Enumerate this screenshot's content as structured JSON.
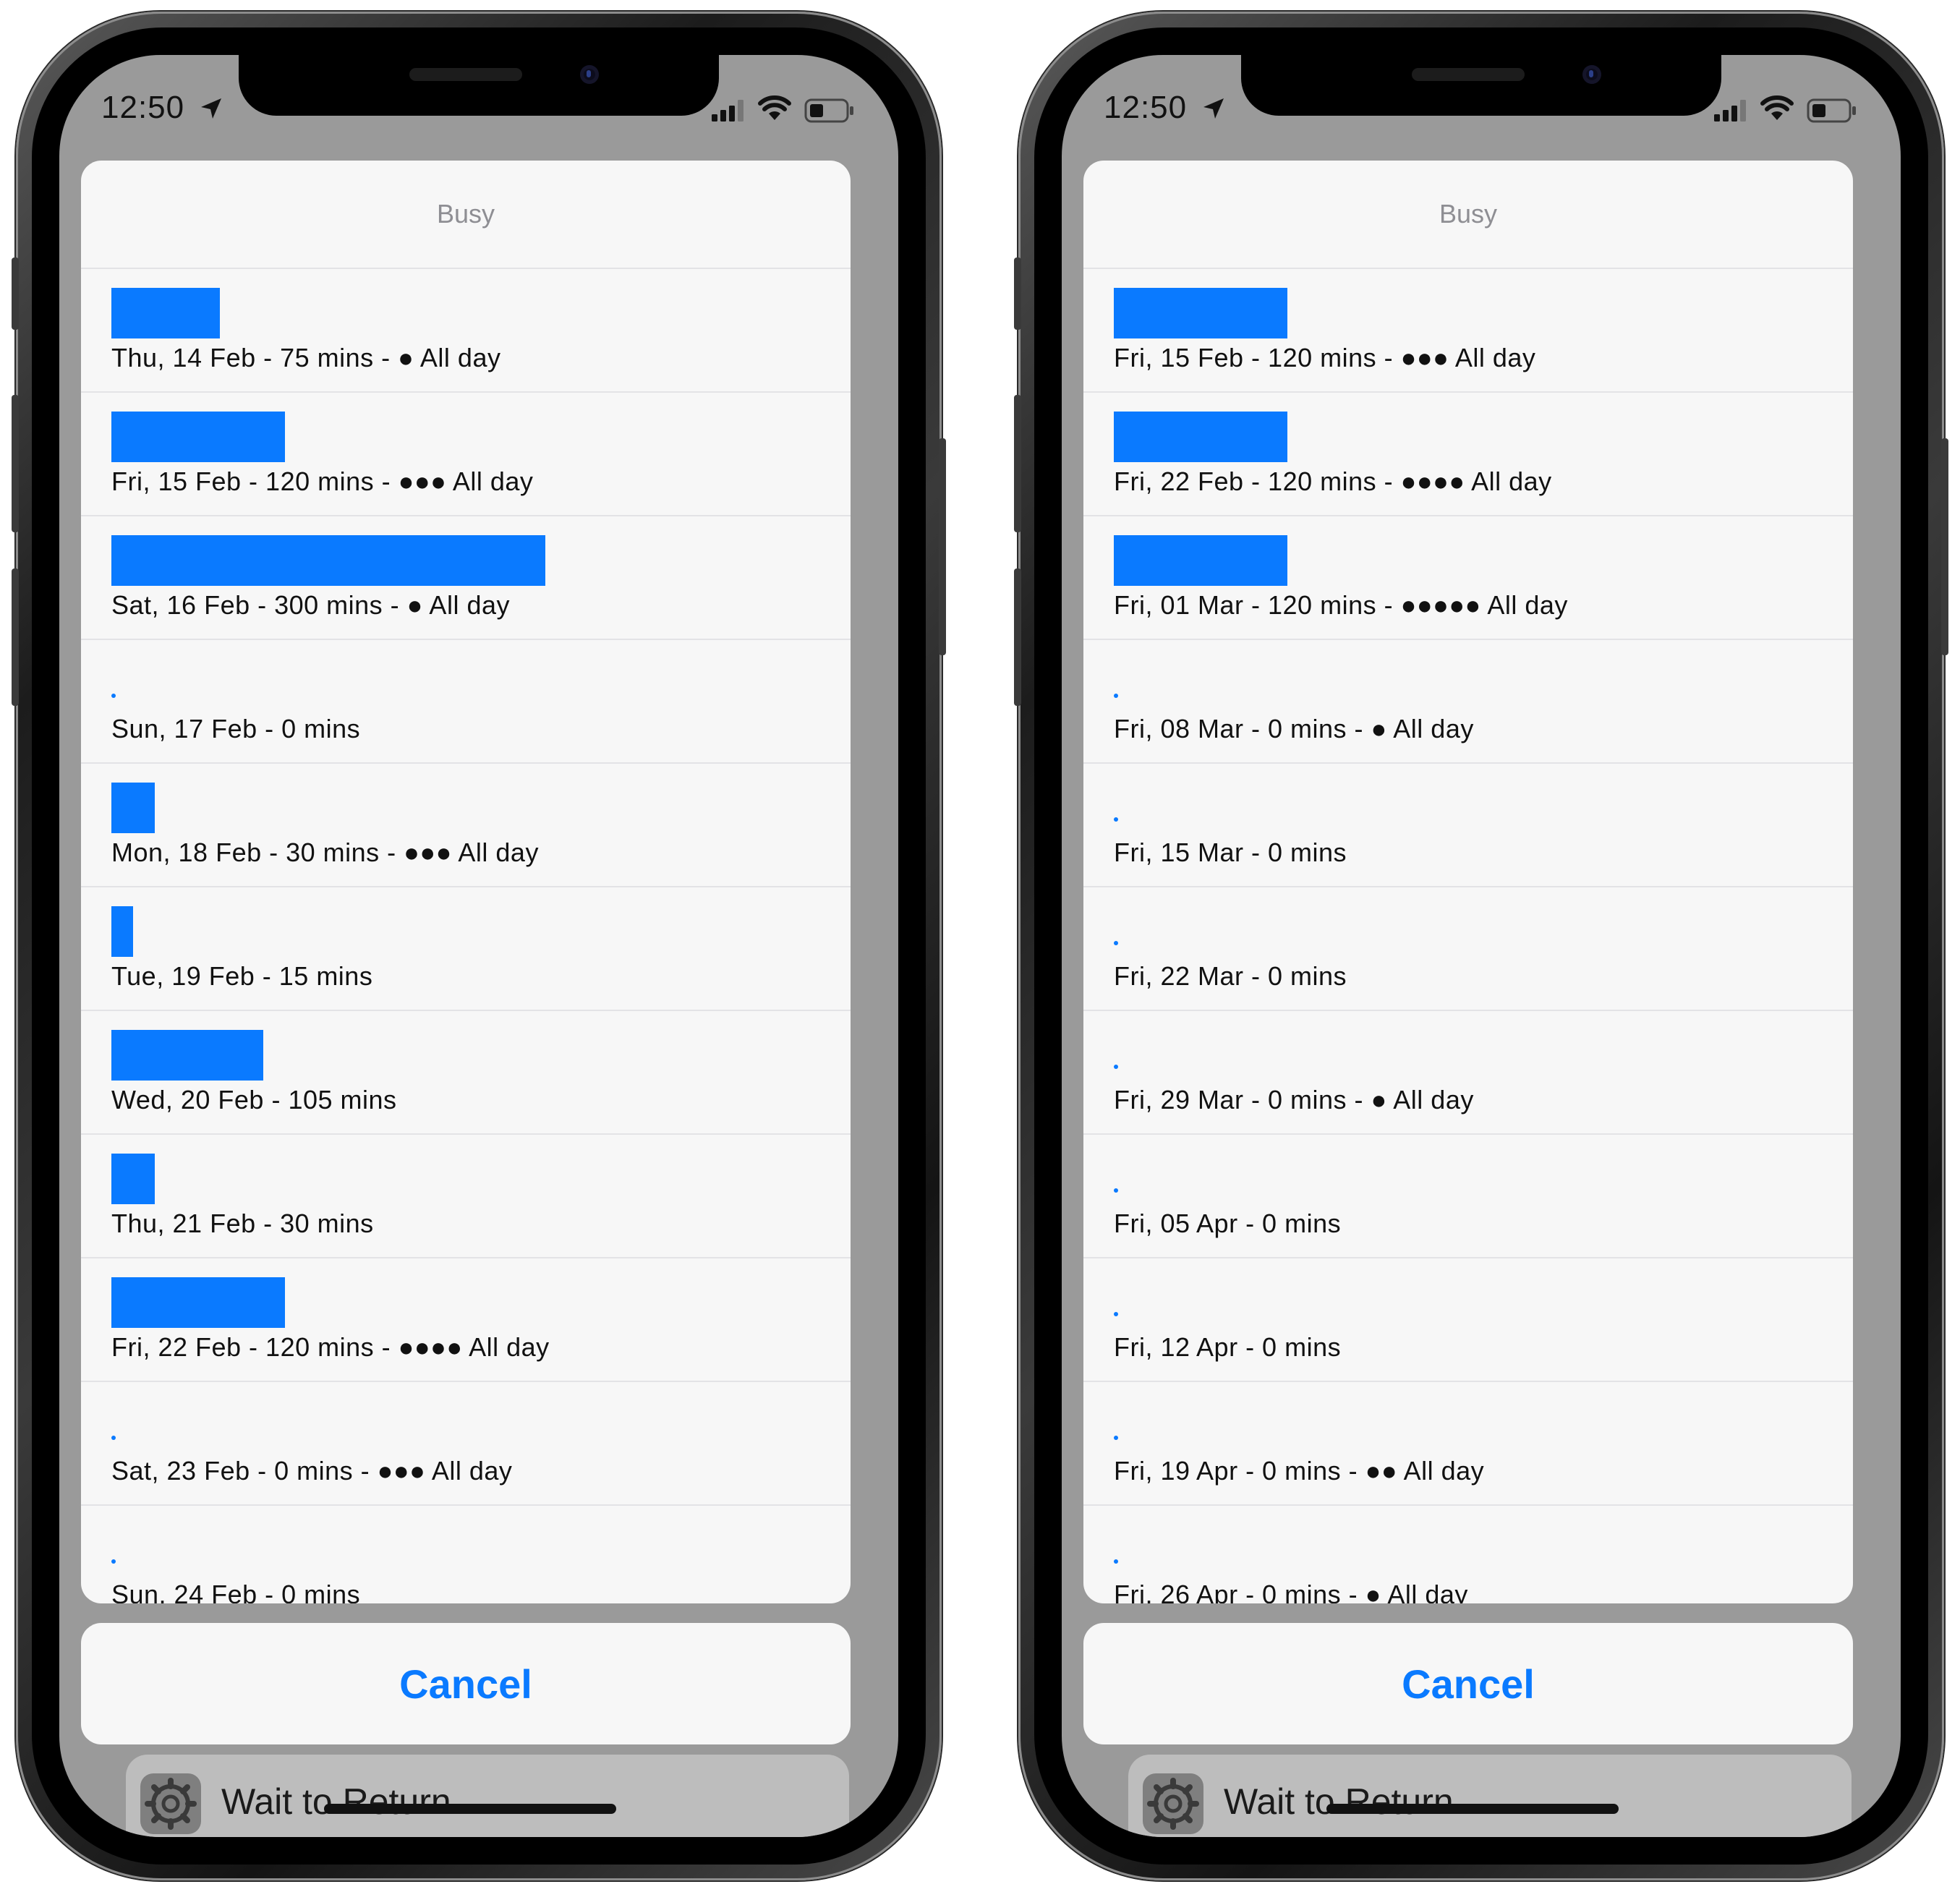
{
  "status_bar": {
    "time": "12:50"
  },
  "colors": {
    "accent": "#0a7aff",
    "sheet_bg": "#f7f7f7",
    "separator": "#e3e3e6",
    "title_gray": "#8e8e93"
  },
  "icons": [
    "location-arrow-icon",
    "cellular-signal-icon",
    "wifi-icon",
    "battery-icon",
    "gear-icon"
  ],
  "phones": [
    {
      "sheet": {
        "title": "Busy",
        "rows": [
          {
            "text": "Thu, 14 Feb - 75 mins - ● All day",
            "minutes": 75
          },
          {
            "text": "Fri, 15 Feb - 120 mins - ●●● All day",
            "minutes": 120
          },
          {
            "text": "Sat, 16 Feb - 300 mins - ● All day",
            "minutes": 300
          },
          {
            "text": "Sun, 17 Feb - 0 mins",
            "minutes": 0
          },
          {
            "text": "Mon, 18 Feb - 30 mins - ●●● All day",
            "minutes": 30
          },
          {
            "text": "Tue, 19 Feb - 15 mins",
            "minutes": 15
          },
          {
            "text": "Wed, 20 Feb - 105 mins",
            "minutes": 105
          },
          {
            "text": "Thu, 21 Feb - 30 mins",
            "minutes": 30
          },
          {
            "text": "Fri, 22 Feb - 120 mins - ●●●● All day",
            "minutes": 120
          },
          {
            "text": "Sat, 23 Feb - 0 mins - ●●● All day",
            "minutes": 0
          },
          {
            "text": "Sun, 24 Feb - 0 mins",
            "minutes": 0
          }
        ]
      },
      "cancel_label": "Cancel",
      "behind_action": "Wait to Return"
    },
    {
      "sheet": {
        "title": "Busy",
        "rows": [
          {
            "text": "Fri, 15 Feb - 120 mins - ●●● All day",
            "minutes": 120
          },
          {
            "text": "Fri, 22 Feb - 120 mins - ●●●● All day",
            "minutes": 120
          },
          {
            "text": "Fri, 01 Mar - 120 mins - ●●●●● All day",
            "minutes": 120
          },
          {
            "text": "Fri, 08 Mar - 0 mins - ● All day",
            "minutes": 0
          },
          {
            "text": "Fri, 15 Mar - 0 mins",
            "minutes": 0
          },
          {
            "text": "Fri, 22 Mar - 0 mins",
            "minutes": 0
          },
          {
            "text": "Fri, 29 Mar - 0 mins - ● All day",
            "minutes": 0
          },
          {
            "text": "Fri, 05 Apr - 0 mins",
            "minutes": 0
          },
          {
            "text": "Fri, 12 Apr - 0 mins",
            "minutes": 0
          },
          {
            "text": "Fri, 19 Apr - 0 mins - ●● All day",
            "minutes": 0
          },
          {
            "text": "Fri, 26 Apr - 0 mins - ● All day",
            "minutes": 0
          }
        ]
      },
      "cancel_label": "Cancel",
      "behind_action": "Wait to Return"
    }
  ]
}
